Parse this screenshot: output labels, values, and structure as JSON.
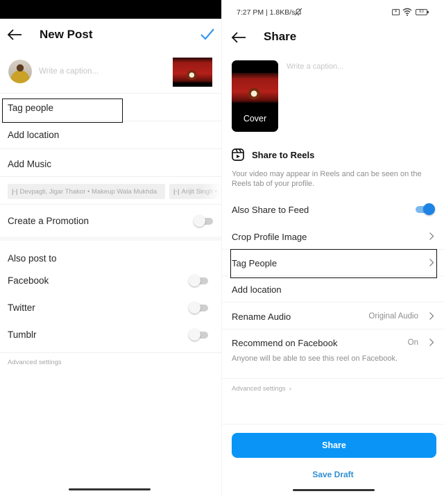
{
  "left_screen": {
    "header": {
      "title": "New Post",
      "back_icon": "arrow-left-icon",
      "confirm_icon": "checkmark-icon",
      "accent_color": "#3897f0"
    },
    "caption": {
      "placeholder": "Write a caption..."
    },
    "rows": [
      {
        "label": "Tag people"
      },
      {
        "label": "Add location"
      },
      {
        "label": "Add Music"
      }
    ],
    "music_suggestions": [
      {
        "icon": "music-bars-icon",
        "text": "Devpagli, Jigar Thakor • Makeup Wala Mukhda"
      },
      {
        "icon": "music-bars-icon",
        "text": "Arijit Singh •"
      }
    ],
    "promotion": {
      "label": "Create a Promotion",
      "enabled": false
    },
    "also_post_to": {
      "heading": "Also post to",
      "items": [
        {
          "label": "Facebook",
          "enabled": false
        },
        {
          "label": "Twitter",
          "enabled": false
        },
        {
          "label": "Tumblr",
          "enabled": false
        }
      ]
    },
    "advanced_settings": "Advanced settings"
  },
  "right_screen": {
    "status_bar": {
      "text": "7:27 PM | 1.8KB/s",
      "icons": [
        "notifications-muted-icon",
        "sim-card-icon",
        "wifi-icon",
        "battery-icon"
      ],
      "battery_level": "83"
    },
    "header": {
      "title": "Share",
      "back_icon": "arrow-left-icon"
    },
    "cover_label": "Cover",
    "caption": {
      "placeholder": "Write a caption..."
    },
    "reels": {
      "icon": "reels-icon",
      "title": "Share to Reels",
      "description": "Your video may appear in Reels and can be seen on the Reels tab of your profile."
    },
    "rows": [
      {
        "label": "Also Share to Feed",
        "type": "toggle",
        "enabled": true
      },
      {
        "label": "Crop Profile Image",
        "type": "link"
      },
      {
        "label": "Tag People",
        "type": "link"
      },
      {
        "label": "Add location",
        "type": "link"
      },
      {
        "label": "Rename Audio",
        "type": "link",
        "value": "Original Audio"
      }
    ],
    "recommend": {
      "label": "Recommend on Facebook",
      "value": "On",
      "subtext": "Anyone will be able to see this reel on Facebook."
    },
    "advanced_settings": "Advanced settings",
    "share_button": "Share",
    "save_draft": "Save Draft",
    "accent_color": "#0a95f6"
  }
}
